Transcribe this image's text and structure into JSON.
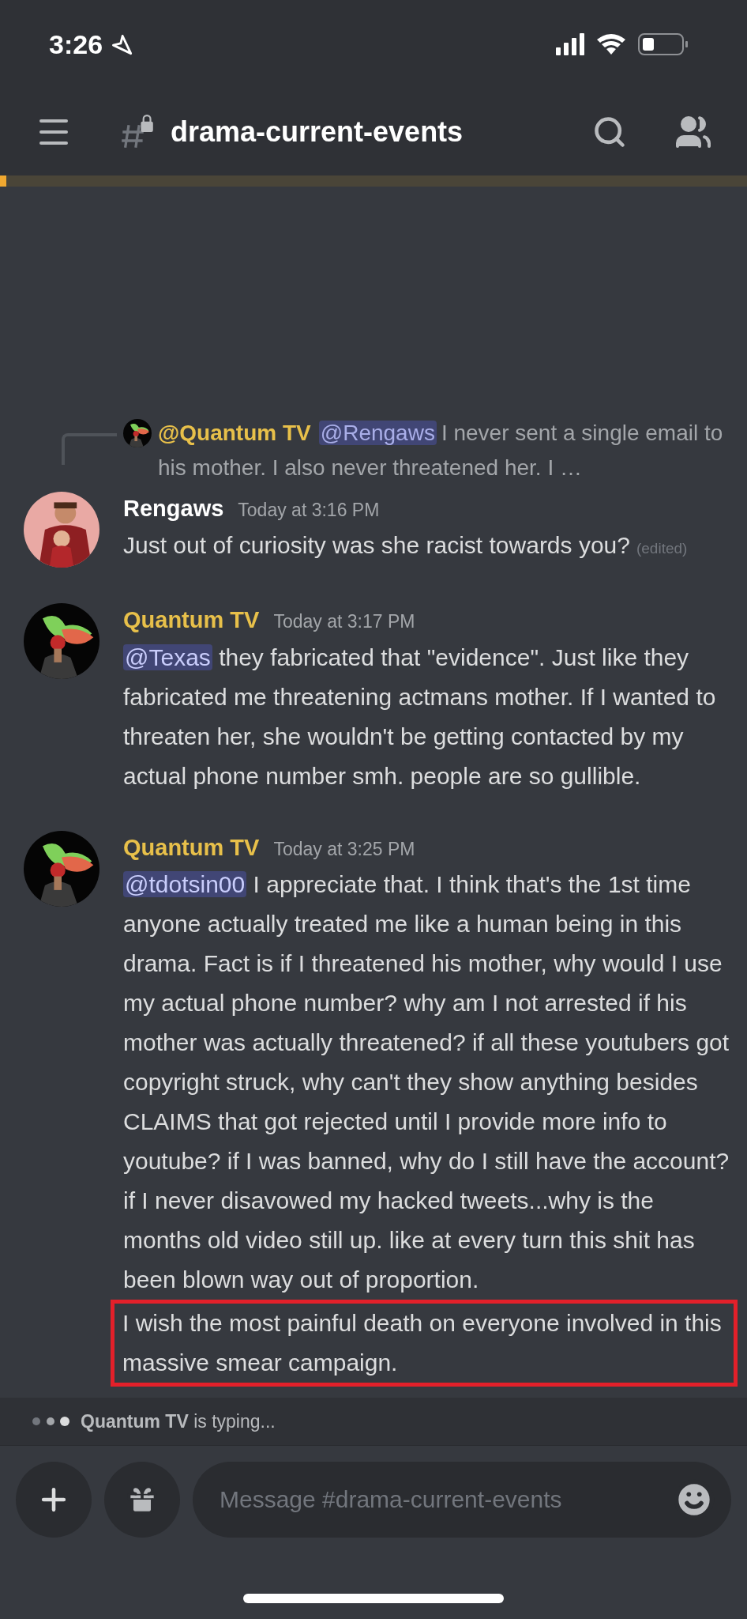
{
  "status_bar": {
    "time": "3:26"
  },
  "header": {
    "channel": "drama-current-events"
  },
  "messages": [
    {
      "reply": {
        "author": "@Quantum TV",
        "mention": "@Rengaws",
        "text": "I never sent a single email to his mother. I also never threatened her. I …"
      },
      "author": "Rengaws",
      "color": "#ffffff",
      "timestamp": "Today at 3:16 PM",
      "content": [
        {
          "kind": "text",
          "text": "Just out of curiosity was she racist towards you?"
        }
      ],
      "edited": "(edited)"
    },
    {
      "author": "Quantum TV",
      "color": "#e8c04a",
      "timestamp": "Today at 3:17 PM",
      "content": [
        {
          "kind": "mention",
          "text": "@Texas"
        },
        {
          "kind": "text",
          "text": " they fabricated that \"evidence\". Just like they fabricated me threatening actmans mother. If I wanted to threaten her, she wouldn't be getting contacted by my actual phone number smh. people are so gullible."
        }
      ]
    },
    {
      "author": "Quantum TV",
      "color": "#e8c04a",
      "timestamp": "Today at 3:25 PM",
      "content": [
        {
          "kind": "mention",
          "text": "@tdotsin00"
        },
        {
          "kind": "text",
          "text": " I appreciate that. I think that's the 1st time anyone actually treated me like a human being in this drama. Fact is if I threatened his mother, why would I use my actual phone number? why am I not arrested if his mother was actually threatened? if all these youtubers got copyright struck, why can't they show anything besides CLAIMS that got rejected until I provide more info to youtube? if I was banned, why do I still have the account? if I never disavowed my hacked tweets...why is the months old video still up. like at every turn this shit has been blown way out of proportion."
        },
        {
          "kind": "highlight",
          "text": "I wish the most painful death on everyone involved in this massive smear campaign."
        }
      ]
    }
  ],
  "typing": {
    "user": "Quantum TV",
    "text": "is typing..."
  },
  "composer": {
    "placeholder": "Message #drama-current-events"
  }
}
